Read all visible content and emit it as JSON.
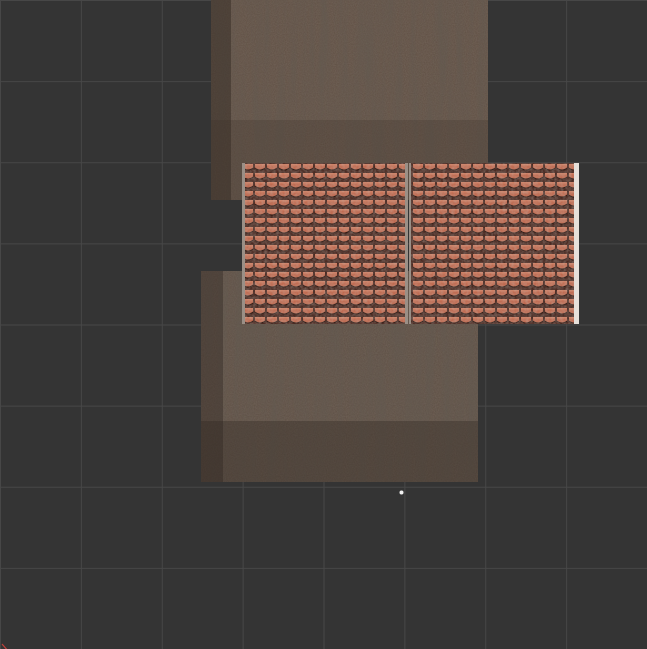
{
  "editor": {
    "panel": "uv-texture-viewport",
    "grid": {
      "background": "#343434",
      "line_color": "#474747",
      "divisions": 8
    },
    "islands": [
      {
        "id": "wall-top",
        "material": "weathered-plaster",
        "base_color": "#574a40"
      },
      {
        "id": "wall-bottom",
        "material": "weathered-plaster",
        "base_color": "#574a40"
      },
      {
        "id": "roof-left",
        "material": "clay-roof-tiles",
        "base_color": "#b5614a"
      },
      {
        "id": "roof-right",
        "material": "clay-roof-tiles",
        "base_color": "#b5614a"
      }
    ],
    "icons": {
      "origin": "uv-origin-icon",
      "pivot": "pivot-point-icon"
    }
  }
}
